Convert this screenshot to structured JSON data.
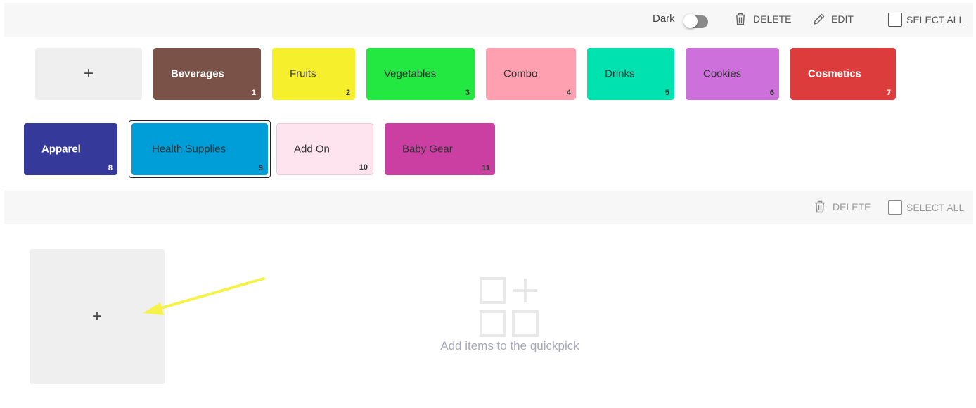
{
  "top_toolbar": {
    "dark_label": "Dark",
    "delete_label": "DELETE",
    "edit_label": "EDIT",
    "select_all_label": "SELECT ALL"
  },
  "categories": {
    "add_symbol": "+",
    "items": [
      {
        "name": "Beverages",
        "index": "1",
        "color": "#7b5247",
        "text_color": "#ffffff"
      },
      {
        "name": "Fruits",
        "index": "2",
        "color": "#f5f02b",
        "text_color": "#333333"
      },
      {
        "name": "Vegetables",
        "index": "3",
        "color": "#22e841",
        "text_color": "#333333"
      },
      {
        "name": "Combo",
        "index": "4",
        "color": "#ffa0b0",
        "text_color": "#333333"
      },
      {
        "name": "Drinks",
        "index": "5",
        "color": "#00e2b0",
        "text_color": "#333333"
      },
      {
        "name": "Cookies",
        "index": "6",
        "color": "#cd70dc",
        "text_color": "#333333"
      },
      {
        "name": "Cosmetics",
        "index": "7",
        "color": "#dd3c3c",
        "text_color": "#ffffff"
      },
      {
        "name": "Apparel",
        "index": "8",
        "color": "#34399a",
        "text_color": "#ffffff"
      },
      {
        "name": "Health Supplies",
        "index": "9",
        "color": "#009ed8",
        "text_color": "#333333",
        "selected": true
      },
      {
        "name": "Add On",
        "index": "10",
        "color": "#fde4ee",
        "text_color": "#333333"
      },
      {
        "name": "Baby Gear",
        "index": "11",
        "color": "#cb3ea2",
        "text_color": "#333333"
      }
    ]
  },
  "bottom_toolbar": {
    "delete_label": "DELETE",
    "select_all_label": "SELECT ALL"
  },
  "quickpick": {
    "add_symbol": "+",
    "empty_message": "Add items to the quickpick"
  }
}
